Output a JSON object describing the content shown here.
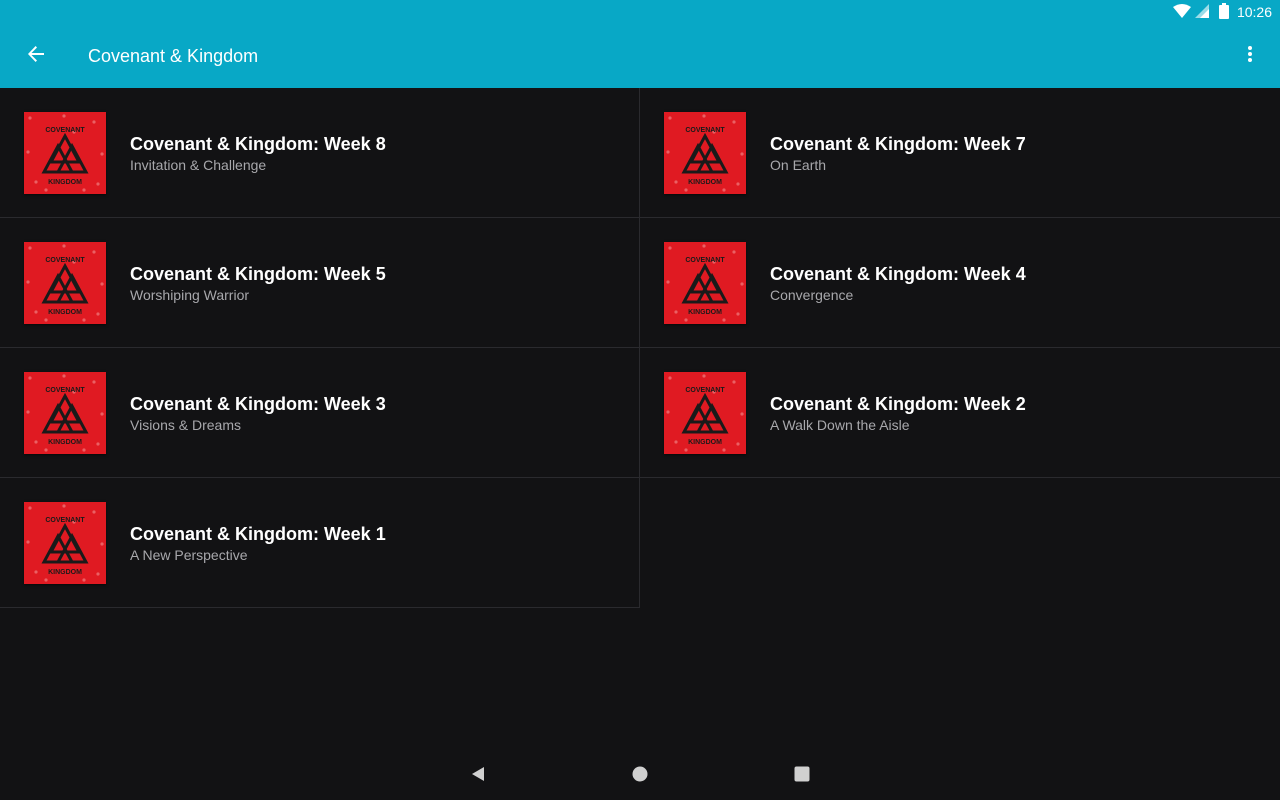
{
  "status_bar": {
    "time": "10:26"
  },
  "app_bar": {
    "title": "Covenant & Kingdom"
  },
  "colors": {
    "accent": "#08a8c6",
    "background": "#121214",
    "thumbnail_red": "#e01a22"
  },
  "thumbnail": {
    "top_text": "COVENANT",
    "bottom_text": "KINGDOM"
  },
  "items": [
    {
      "title": "Covenant & Kingdom: Week 8",
      "subtitle": "Invitation & Challenge"
    },
    {
      "title": "Covenant & Kingdom: Week 7",
      "subtitle": "On Earth"
    },
    {
      "title": "Covenant & Kingdom: Week 5",
      "subtitle": "Worshiping Warrior"
    },
    {
      "title": "Covenant & Kingdom: Week 4",
      "subtitle": "Convergence"
    },
    {
      "title": "Covenant & Kingdom: Week 3",
      "subtitle": "Visions & Dreams"
    },
    {
      "title": "Covenant & Kingdom: Week 2",
      "subtitle": "A Walk Down the Aisle"
    },
    {
      "title": "Covenant & Kingdom: Week 1",
      "subtitle": "A New Perspective"
    }
  ],
  "icons": {
    "back": "arrow-back-icon",
    "overflow": "more-vert-icon",
    "wifi": "wifi-icon",
    "signal": "signal-icon",
    "battery": "battery-icon",
    "nav_back": "nav-back-icon",
    "nav_home": "nav-home-icon",
    "nav_recents": "nav-recents-icon"
  }
}
